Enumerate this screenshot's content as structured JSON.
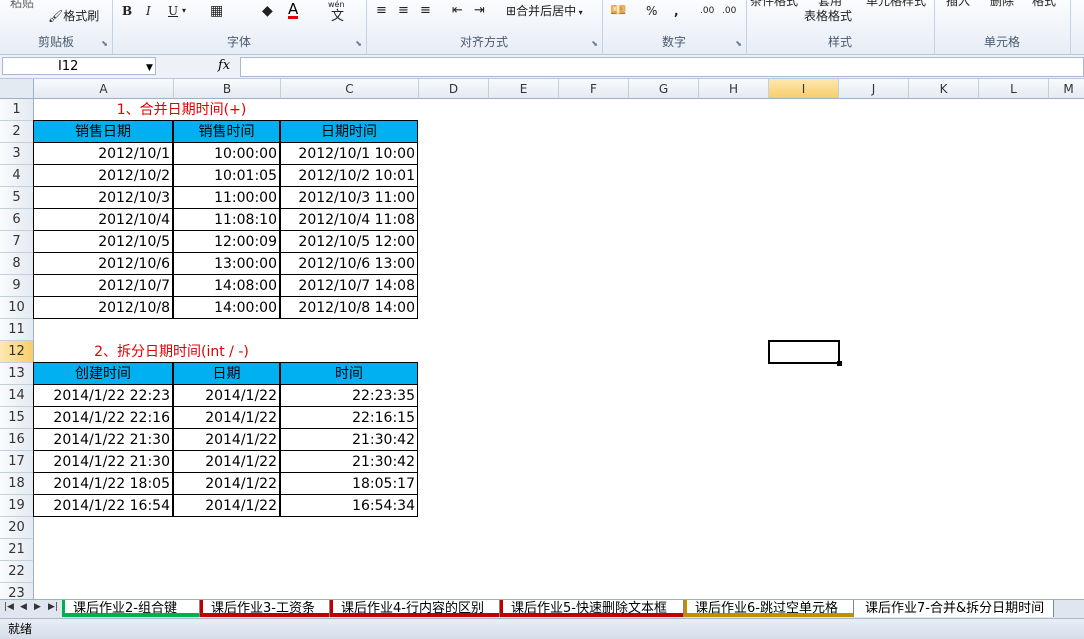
{
  "ribbon": {
    "clipboard": {
      "paste_label": "粘贴",
      "format_painter_label": "格式刷",
      "group_label": "剪贴板"
    },
    "font": {
      "bold": "B",
      "italic": "I",
      "underline": "U",
      "phonetic_label": "wén",
      "phonetic_char": "文",
      "font_color_glyph": "A",
      "group_label": "字体"
    },
    "alignment": {
      "merge_center_label": "合并后居中",
      "group_label": "对齐方式"
    },
    "number": {
      "percent": "%",
      "comma": ",",
      "inc_decimal": ".00",
      "dec_decimal": ".00",
      "group_label": "数字"
    },
    "styles": {
      "conditional_label": "条件格式",
      "table_format_top": "套用",
      "table_format_label": "表格格式",
      "cell_styles_label": "单元格样式",
      "group_label": "样式"
    },
    "cells": {
      "insert_label": "插入",
      "delete_label": "删除",
      "format_label": "格式",
      "group_label": "单元格"
    }
  },
  "formula_bar": {
    "name_box": "I12",
    "fx": "fx",
    "formula": ""
  },
  "columns": [
    "A",
    "B",
    "C",
    "D",
    "E",
    "F",
    "G",
    "H",
    "I",
    "J",
    "K",
    "L",
    "M"
  ],
  "rows": [
    "1",
    "2",
    "3",
    "4",
    "5",
    "6",
    "7",
    "8",
    "9",
    "10",
    "11",
    "12",
    "13",
    "14",
    "15",
    "16",
    "17",
    "18",
    "19",
    "20",
    "21",
    "22",
    "23"
  ],
  "selected": {
    "column": "I",
    "row": "12"
  },
  "sheet": {
    "title1": "1、合并日期时间(+)",
    "table1": {
      "headers": [
        "销售日期",
        "销售时间",
        "日期时间"
      ],
      "rows": [
        [
          "2012/10/1",
          "10:00:00",
          "2012/10/1 10:00"
        ],
        [
          "2012/10/2",
          "10:01:05",
          "2012/10/2 10:01"
        ],
        [
          "2012/10/3",
          "11:00:00",
          "2012/10/3 11:00"
        ],
        [
          "2012/10/4",
          "11:08:10",
          "2012/10/4 11:08"
        ],
        [
          "2012/10/5",
          "12:00:09",
          "2012/10/5 12:00"
        ],
        [
          "2012/10/6",
          "13:00:00",
          "2012/10/6 13:00"
        ],
        [
          "2012/10/7",
          "14:08:00",
          "2012/10/7 14:08"
        ],
        [
          "2012/10/8",
          "14:00:00",
          "2012/10/8 14:00"
        ]
      ]
    },
    "title2": "2、拆分日期时间(int /  -)",
    "table2": {
      "headers": [
        "创建时间",
        "日期",
        "时间"
      ],
      "rows": [
        [
          "2014/1/22 22:23",
          "2014/1/22",
          "22:23:35"
        ],
        [
          "2014/1/22 22:16",
          "2014/1/22",
          "22:16:15"
        ],
        [
          "2014/1/22 21:30",
          "2014/1/22",
          "21:30:42"
        ],
        [
          "2014/1/22 21:30",
          "2014/1/22",
          "21:30:42"
        ],
        [
          "2014/1/22 18:05",
          "2014/1/22",
          "18:05:17"
        ],
        [
          "2014/1/22 16:54",
          "2014/1/22",
          "16:54:34"
        ]
      ]
    }
  },
  "tabs": [
    {
      "label": "课后作业2-组合键",
      "color": "#00b050"
    },
    {
      "label": "课后作业3-工资条",
      "color": "#c00000"
    },
    {
      "label": "课后作业4-行内容的区别",
      "color": "#c00000"
    },
    {
      "label": "课后作业5-快速删除文本框",
      "color": "#c00000"
    },
    {
      "label": "课后作业6-跳过空单元格",
      "color": "#c09000"
    },
    {
      "label": "课后作业7-合并&拆分日期时间",
      "color": "#ffffff"
    }
  ],
  "status": {
    "ready": "就绪"
  },
  "colors": {
    "header_fill": "#00b0f0",
    "title_text": "#e00000"
  }
}
